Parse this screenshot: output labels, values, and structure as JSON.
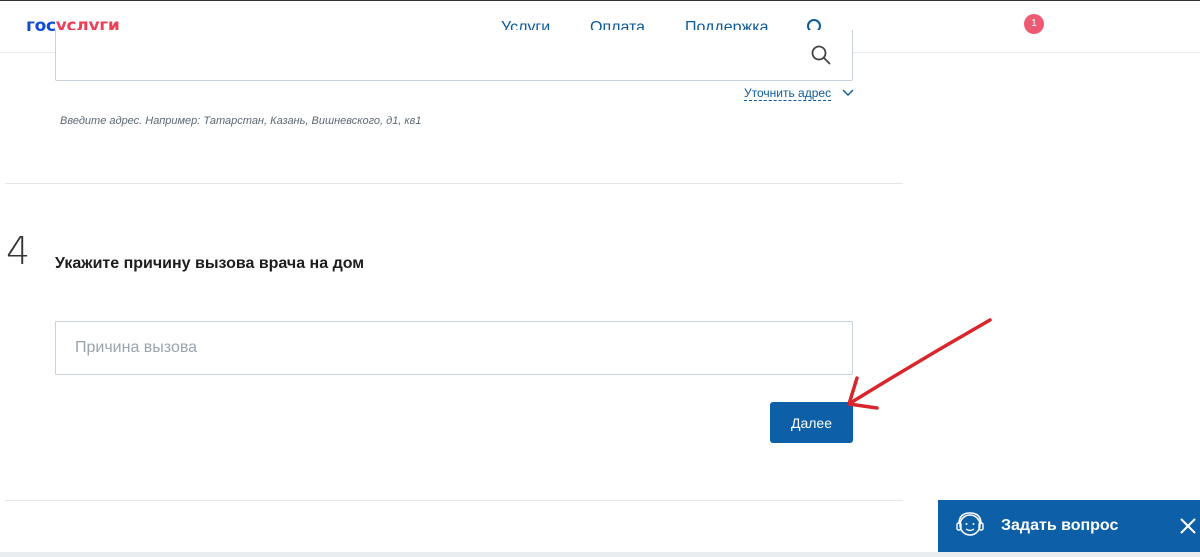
{
  "header": {
    "logo_part1": "гос",
    "logo_part2": "услуги",
    "nav": [
      "Услуги",
      "Оплата",
      "Поддержка"
    ],
    "notification_count": "1"
  },
  "address": {
    "refine_link": "Уточнить адрес",
    "hint": "Введите адрес. Например: Татарстан, Казань, Вишневского, д1, кв1"
  },
  "step": {
    "number": "4",
    "title": "Укажите причину вызова врача на дом",
    "input_placeholder": "Причина вызова",
    "next_label": "Далее"
  },
  "ask_widget": {
    "label": "Задать вопрос"
  },
  "colors": {
    "brand_blue": "#0d4cd3",
    "brand_red": "#ee3f58",
    "button_blue": "#0d5fa8",
    "annotation_arrow": "#d8262c"
  },
  "icons": [
    "search-icon",
    "chevron-down-icon",
    "support-agent-icon",
    "close-icon"
  ]
}
